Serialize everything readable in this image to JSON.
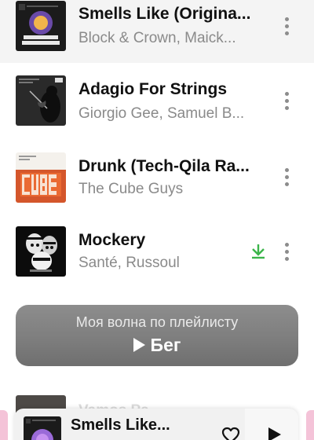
{
  "tracks": [
    {
      "title": "Smells Like (Origina...",
      "artist": "Block & Crown, Maick...",
      "cover_icon": "save-the-nightlife-cover",
      "cover_text": "SAVE THE NIGHTLIFE",
      "downloaded": false
    },
    {
      "title": "Adagio For Strings",
      "artist": "Giorgio Gee, Samuel B...",
      "cover_icon": "violinist-cover",
      "cover_text": "NO",
      "downloaded": false
    },
    {
      "title": "Drunk (Tech-Qila Ra...",
      "artist": "The Cube Guys",
      "cover_icon": "cube-cover",
      "cover_text": "CUBE",
      "downloaded": false
    },
    {
      "title": "Mockery",
      "artist": "Santé, Russoul",
      "cover_icon": "bw-faces-cover",
      "cover_text": "",
      "downloaded": true
    }
  ],
  "wave": {
    "title": "Моя волна по плейлисту",
    "play_label": "Бег"
  },
  "next_row": {
    "title": "Vamos Pa..."
  },
  "mini_player": {
    "title": "Smells Like...",
    "heart_icon": "heart-outline-icon",
    "play_icon": "play-icon"
  },
  "colors": {
    "title_text": "#111111",
    "artist_text": "#8a8a8a",
    "download_green": "#3bb54a",
    "wave_gray": "#838383",
    "mini_player_bg": "#f1f1f1",
    "chip_pink": "#f4c3d8"
  }
}
